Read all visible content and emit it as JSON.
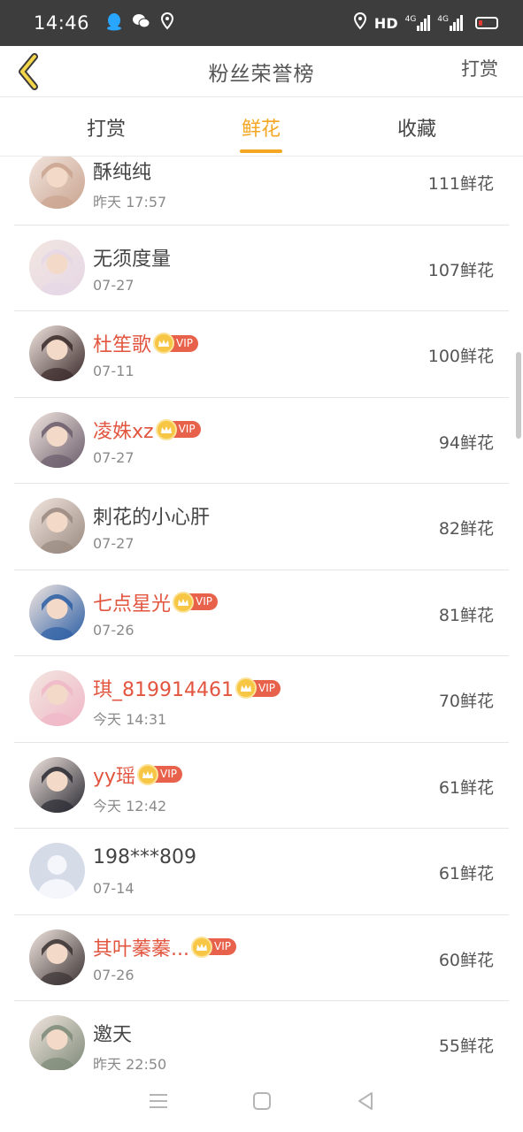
{
  "status_bar": {
    "time": "14:46",
    "hd_label": "HD",
    "net1": "4G",
    "net2": "4G"
  },
  "header": {
    "title": "粉丝荣誉榜",
    "action": "打赏"
  },
  "tabs": [
    {
      "label": "打赏",
      "active": false
    },
    {
      "label": "鲜花",
      "active": true
    },
    {
      "label": "收藏",
      "active": false
    }
  ],
  "vip_label": "VIP",
  "fans": [
    {
      "name": "酥纯纯",
      "vip": false,
      "date": "昨天 17:57",
      "count": "111鲜花",
      "avatar_color": "#caa48f"
    },
    {
      "name": "无须度量",
      "vip": false,
      "date": "07-27",
      "count": "107鲜花",
      "avatar_color": "#e6d7e6"
    },
    {
      "name": "杜笙歌",
      "vip": true,
      "date": "07-11",
      "count": "100鲜花",
      "avatar_color": "#3a2a2a"
    },
    {
      "name": "凌姝xz",
      "vip": true,
      "date": "07-27",
      "count": "94鲜花",
      "avatar_color": "#6b5d6b"
    },
    {
      "name": "刺花的小心肝",
      "vip": false,
      "date": "07-27",
      "count": "82鲜花",
      "avatar_color": "#9a8a80"
    },
    {
      "name": "七点星光",
      "vip": true,
      "date": "07-26",
      "count": "81鲜花",
      "avatar_color": "#2d5fa5"
    },
    {
      "name": "琪_819914461",
      "vip": true,
      "date": "今天 14:31",
      "count": "70鲜花",
      "avatar_color": "#f0b7c7"
    },
    {
      "name": "yy瑶",
      "vip": true,
      "date": "今天 12:42",
      "count": "61鲜花",
      "avatar_color": "#2b2b33"
    },
    {
      "name": "198***809",
      "vip": false,
      "date": "07-14",
      "count": "61鲜花",
      "avatar_color": "#d6dbe8",
      "default_avatar": true
    },
    {
      "name": "其叶蓁蓁...",
      "vip": true,
      "date": "07-26",
      "count": "60鲜花",
      "avatar_color": "#3b3333"
    },
    {
      "name": "邀天",
      "vip": false,
      "date": "昨天 22:50",
      "count": "55鲜花",
      "avatar_color": "#7d8a78"
    }
  ],
  "colors": {
    "accent": "#f5a623",
    "vip_name": "#e2553f",
    "status_bar_bg": "#3d3d3d"
  }
}
